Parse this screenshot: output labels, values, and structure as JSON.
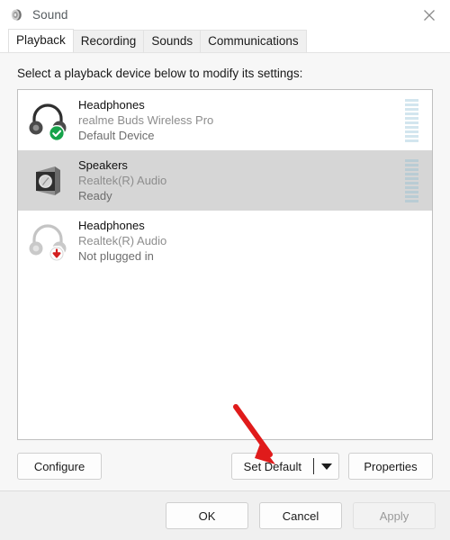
{
  "window": {
    "title": "Sound",
    "icon": "sound-speaker-icon",
    "close_label": "×"
  },
  "tabs": [
    {
      "label": "Playback",
      "selected": true
    },
    {
      "label": "Recording",
      "selected": false
    },
    {
      "label": "Sounds",
      "selected": false
    },
    {
      "label": "Communications",
      "selected": false
    }
  ],
  "main": {
    "hint": "Select a playback device below to modify its settings:",
    "devices": [
      {
        "name": "Headphones",
        "driver": "realme Buds Wireless Pro",
        "state": "Default Device",
        "icon": "headphones-icon",
        "badge": "green-check-badge",
        "selected": false,
        "enabled": true,
        "meter_segments": 10
      },
      {
        "name": "Speakers",
        "driver": "Realtek(R) Audio",
        "state": "Ready",
        "icon": "speaker-box-icon",
        "badge": "none",
        "selected": true,
        "enabled": true,
        "meter_segments": 10
      },
      {
        "name": "Headphones",
        "driver": "Realtek(R) Audio",
        "state": "Not plugged in",
        "icon": "headphones-icon",
        "badge": "red-down-arrow-badge",
        "selected": false,
        "enabled": false,
        "meter_segments": 0
      }
    ]
  },
  "actions": {
    "configure": "Configure",
    "set_default": "Set Default",
    "set_default_dropdown": "set-default-dropdown",
    "properties": "Properties"
  },
  "footer": {
    "ok": "OK",
    "cancel": "Cancel",
    "apply": "Apply",
    "apply_disabled": true
  },
  "annotation": {
    "arrow_color": "#e01b1b",
    "points_to": "Set Default"
  },
  "colors": {
    "accent_green": "#16a34a",
    "accent_red": "#d31f1f",
    "selection_gray": "#d6d6d6",
    "meter_blue": "#d3e6ef",
    "dialog_bg": "#f0f0f0"
  }
}
